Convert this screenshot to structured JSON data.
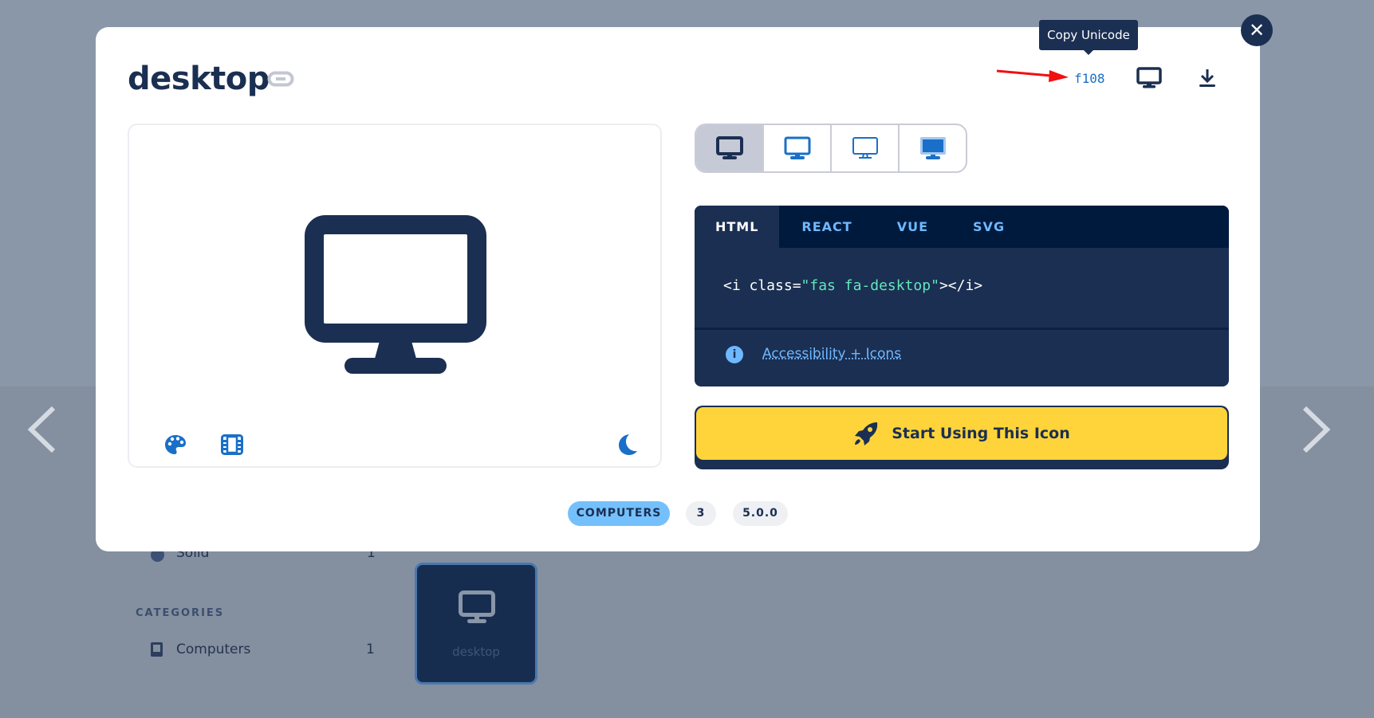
{
  "background": {
    "sidebar_solid_label": "Solid",
    "sidebar_solid_count": "1",
    "categories_heading": "CATEGORIES",
    "category_computers_label": "Computers",
    "category_computers_count": "1",
    "card_label": "desktop"
  },
  "modal": {
    "title": "desktop",
    "tooltip": "Copy Unicode",
    "unicode": "f108",
    "styles": [
      "solid",
      "regular",
      "light",
      "duotone"
    ],
    "code_tabs": [
      "HTML",
      "REACT",
      "VUE",
      "SVG"
    ],
    "active_tab": "HTML",
    "snippet": {
      "open": "<i class=",
      "value": "\"fas fa-desktop\"",
      "close": "></i>"
    },
    "accessibility_link": "Accessibility + Icons",
    "start_button": "Start Using This Icon",
    "tags": [
      "COMPUTERS",
      "3",
      "5.0.0"
    ]
  },
  "colors": {
    "navy": "#1b2f52",
    "accent_blue": "#1a6fc8",
    "yellow": "#ffd43b",
    "tag_blue": "#74c0fc"
  }
}
